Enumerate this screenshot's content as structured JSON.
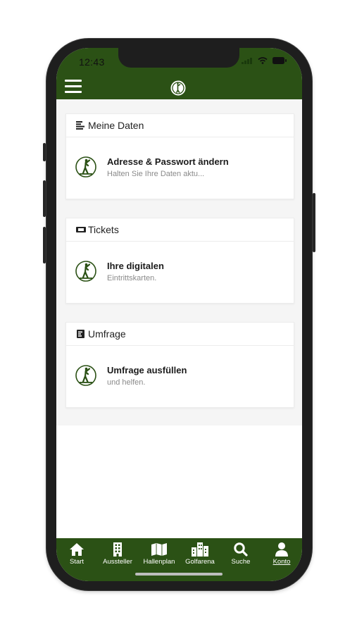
{
  "status_bar": {
    "time": "12:43"
  },
  "sections": [
    {
      "id": "meine-daten",
      "header": "Meine Daten",
      "header_icon": "list-lines-icon",
      "item": {
        "title": "Adresse & Passwort ändern",
        "subtitle": "Halten Sie Ihre Daten aktu..."
      }
    },
    {
      "id": "tickets",
      "header": "Tickets",
      "header_icon": "ticket-icon",
      "item": {
        "title": "Ihre digitalen",
        "subtitle": "Eintrittskarten."
      }
    },
    {
      "id": "umfrage",
      "header": "Umfrage",
      "header_icon": "poll-icon",
      "item": {
        "title": "Umfrage ausfüllen",
        "subtitle": "und helfen."
      }
    }
  ],
  "tabs": [
    {
      "label": "Start",
      "icon": "home-icon"
    },
    {
      "label": "Aussteller",
      "icon": "building-icon"
    },
    {
      "label": "Hallenplan",
      "icon": "map-icon"
    },
    {
      "label": "Golfarena",
      "icon": "city-icon"
    },
    {
      "label": "Suche",
      "icon": "search-icon"
    },
    {
      "label": "Konto",
      "icon": "user-icon",
      "active": true
    }
  ],
  "colors": {
    "brand_green": "#2b5115",
    "background": "#f5f5f5",
    "subtitle_gray": "#8a8a8a"
  }
}
